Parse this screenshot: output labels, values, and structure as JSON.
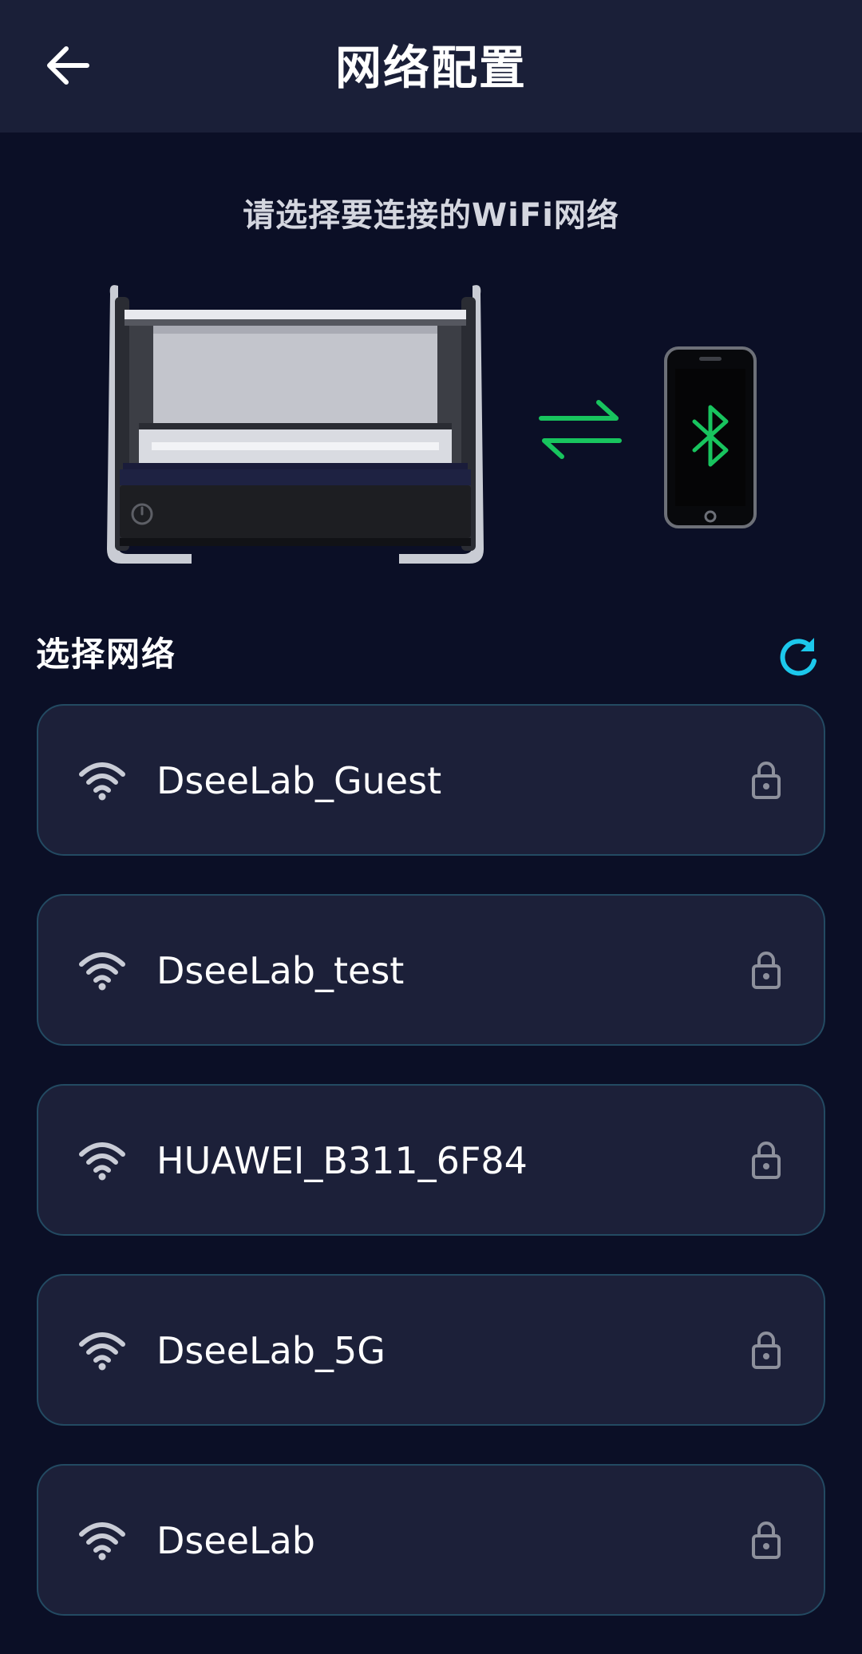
{
  "header": {
    "title": "网络配置"
  },
  "prompt_text": "请选择要连接的WiFi网络",
  "section": {
    "title": "选择网络"
  },
  "networks": [
    {
      "ssid": "DseeLab_Guest",
      "secured": true
    },
    {
      "ssid": "DseeLab_test",
      "secured": true
    },
    {
      "ssid": "HUAWEI_B311_6F84",
      "secured": true
    },
    {
      "ssid": "DseeLab_5G",
      "secured": true
    },
    {
      "ssid": "DseeLab",
      "secured": true
    }
  ],
  "icons": {
    "back": "arrow-left-icon",
    "refresh": "refresh-icon",
    "wifi": "wifi-icon",
    "lock": "lock-icon",
    "bluetooth": "bluetooth-icon",
    "swap": "swap-arrows-icon"
  },
  "colors": {
    "background": "#0b0f26",
    "app_bar": "#1a1f38",
    "card": "#1c2039",
    "card_border": "#234a62",
    "accent_cyan": "#1cc8ec",
    "accent_green": "#18c45e",
    "muted_icon": "#c9ccd6"
  }
}
